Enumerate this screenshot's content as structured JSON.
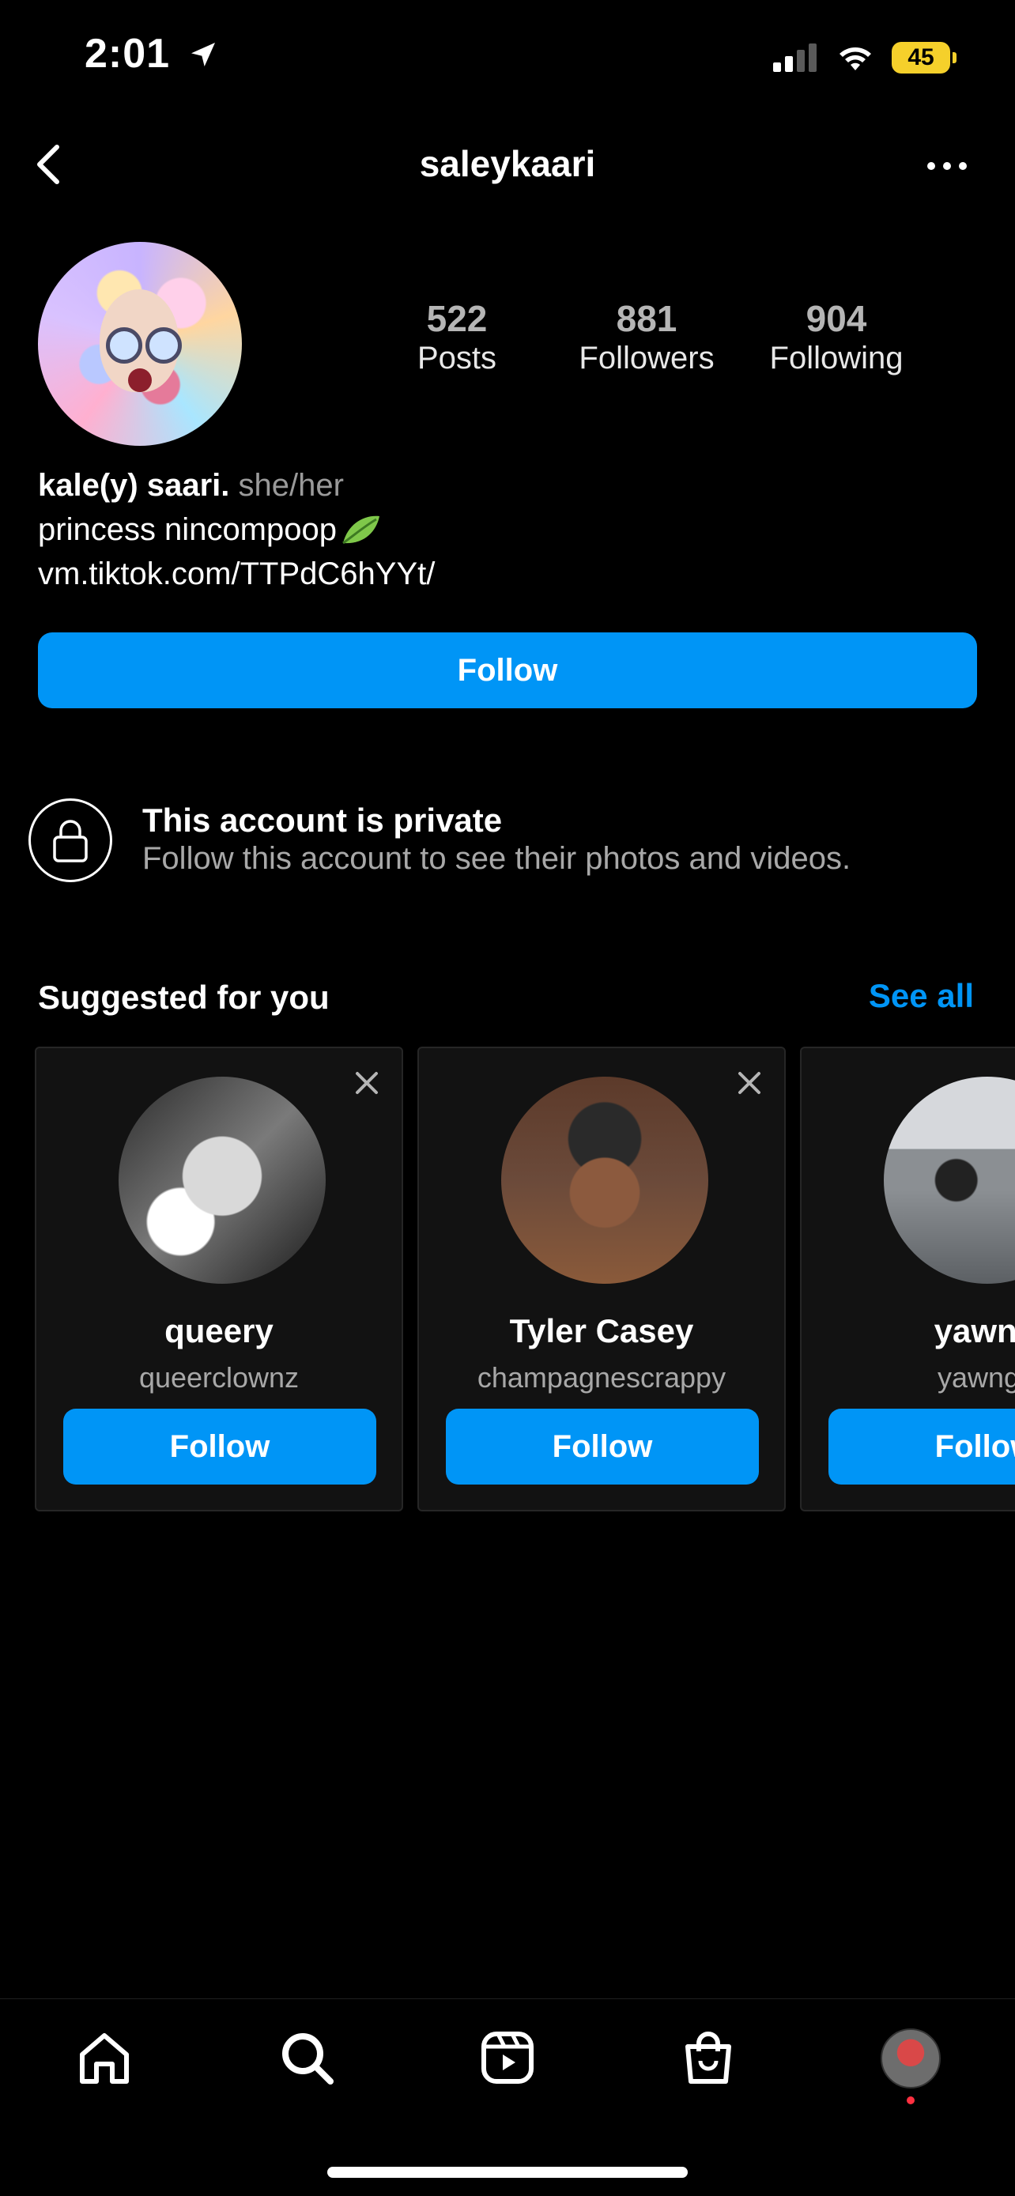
{
  "status_bar": {
    "time": "2:01",
    "battery": "45"
  },
  "header": {
    "username": "saleykaari"
  },
  "profile": {
    "stats": [
      {
        "value": "522",
        "label": "Posts"
      },
      {
        "value": "881",
        "label": "Followers"
      },
      {
        "value": "904",
        "label": "Following"
      }
    ],
    "display_name": "kale(y) saari.",
    "pronouns": "she/her",
    "bio_line": "princess nincompoop",
    "link": "vm.tiktok.com/TTPdC6hYYt/",
    "follow_label": "Follow"
  },
  "private_notice": {
    "title": "This account is private",
    "subtitle": "Follow this account to see their photos and videos."
  },
  "suggested": {
    "title": "Suggested for you",
    "see_all": "See all",
    "cards": [
      {
        "name": "queery",
        "handle": "queerclownz",
        "button": "Follow"
      },
      {
        "name": "Tyler Casey",
        "handle": "champagnescrappy",
        "button": "Follow"
      },
      {
        "name": "yawng",
        "handle": "yawngc",
        "button": "Follow"
      }
    ]
  },
  "tab_bar": {
    "items": [
      "home-icon",
      "search-icon",
      "reels-icon",
      "shop-icon",
      "profile-avatar"
    ]
  },
  "colors": {
    "accent": "#0095f6",
    "background": "#000000",
    "card": "#121212",
    "battery": "#f5d02b"
  }
}
